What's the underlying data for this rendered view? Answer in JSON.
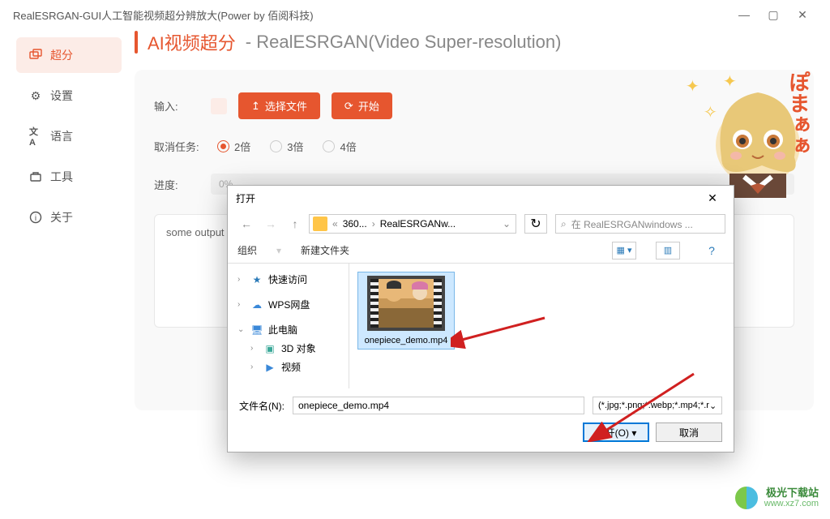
{
  "window": {
    "title": "RealESRGAN-GUI人工智能视频超分辨放大(Power by 佰阅科技)"
  },
  "sidebar": {
    "items": [
      {
        "label": "超分",
        "icon": "upscale-icon"
      },
      {
        "label": "设置",
        "icon": "gear-icon"
      },
      {
        "label": "语言",
        "icon": "language-icon"
      },
      {
        "label": "工具",
        "icon": "toolbox-icon"
      },
      {
        "label": "关于",
        "icon": "info-icon"
      }
    ],
    "active_index": 0
  },
  "page": {
    "title": "AI视频超分",
    "separator": " - ",
    "subtitle": "RealESRGAN(Video Super-resolution)"
  },
  "form": {
    "input_label": "输入:",
    "select_file_btn": "选择文件",
    "start_btn": "开始",
    "cancel_label": "取消任务:",
    "scale_options": [
      "2倍",
      "3倍",
      "4倍"
    ],
    "scale_selected": 0,
    "progress_label": "进度:",
    "progress_value": "0%",
    "output_placeholder": "some output"
  },
  "dialog": {
    "title": "打开",
    "breadcrumb": [
      "360...",
      "RealESRGANw..."
    ],
    "search_placeholder": "在 RealESRGANwindows ...",
    "organize": "组织",
    "new_folder": "新建文件夹",
    "tree": [
      {
        "label": "快速访问",
        "icon": "star"
      },
      {
        "label": "WPS网盘",
        "icon": "cloud"
      },
      {
        "label": "此电脑",
        "icon": "pc"
      },
      {
        "label": "3D 对象",
        "icon": "cube",
        "indent": true
      },
      {
        "label": "视频",
        "icon": "video",
        "indent": true
      }
    ],
    "files": [
      {
        "name": "onepiece_demo.mp4",
        "selected": true
      }
    ],
    "filename_label": "文件名(N):",
    "filename_value": "onepiece_demo.mp4",
    "filter": "(*.jpg;*.png;*.webp;*.mp4;*.r",
    "open_btn": "打开(O)",
    "cancel_btn": "取消"
  },
  "mascot": {
    "ja_text": "ぽまぁぁ"
  },
  "watermark": {
    "name": "极光下载站",
    "url": "www.xz7.com"
  },
  "colors": {
    "accent": "#e6562f",
    "accent_light": "#fcece7"
  }
}
